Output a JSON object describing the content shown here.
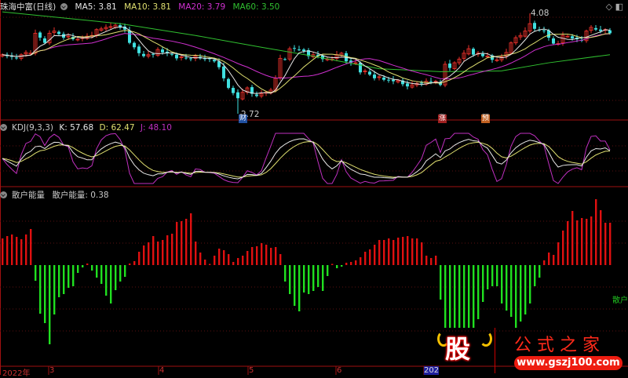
{
  "header": {
    "stock_name": "珠海中富(日线)",
    "ma5": "MA5: 3.81",
    "ma10": "MA10: 3.81",
    "ma20": "MA20: 3.79",
    "ma60": "MA60: 3.50",
    "high_label": "4.08",
    "low_label": "2.72"
  },
  "kdj": {
    "title": "KDJ(9,3,3)",
    "k": "K: 57.68",
    "d": "D: 62.47",
    "j": "J: 48.10"
  },
  "energy": {
    "title": "散户能量",
    "value": "散户能量: 0.38",
    "right_label": "散户"
  },
  "markers": {
    "cai": "财",
    "zhang": "涨",
    "yu": "预"
  },
  "time_axis": {
    "year": "2022年",
    "m3": "3",
    "m4": "4",
    "m5": "5",
    "m6": "6",
    "current": "202"
  },
  "watermark": {
    "logo": "股",
    "title": "公式之家",
    "url": "www.gszj100.com"
  },
  "colors": {
    "up": "#e8302a",
    "down": "#40e0e0",
    "ma5": "#e8e8e8",
    "ma10": "#e0e070",
    "ma20": "#d030d0",
    "ma60": "#30c030",
    "bar_up": "#e01010",
    "bar_down": "#20e020",
    "k": "#e8e8e8",
    "d": "#e0e070",
    "j": "#c030c0"
  },
  "chart_data": {
    "type": "candlestick",
    "price_range": [
      2.72,
      4.08
    ],
    "closes": [
      3.52,
      3.5,
      3.49,
      3.47,
      3.52,
      3.55,
      3.54,
      3.81,
      3.75,
      3.68,
      3.81,
      3.84,
      3.8,
      3.75,
      3.77,
      3.73,
      3.73,
      3.75,
      3.77,
      3.78,
      3.86,
      3.87,
      3.89,
      3.9,
      3.92,
      3.89,
      3.86,
      3.68,
      3.62,
      3.54,
      3.5,
      3.52,
      3.52,
      3.59,
      3.55,
      3.54,
      3.52,
      3.47,
      3.49,
      3.47,
      3.46,
      3.5,
      3.47,
      3.46,
      3.46,
      3.43,
      3.35,
      3.2,
      3.07,
      3.0,
      2.93,
      3.01,
      3.07,
      2.99,
      2.96,
      2.99,
      3.01,
      3.04,
      3.2,
      3.47,
      3.46,
      3.6,
      3.6,
      3.59,
      3.57,
      3.5,
      3.52,
      3.5,
      3.46,
      3.46,
      3.46,
      3.52,
      3.54,
      3.43,
      3.41,
      3.41,
      3.28,
      3.3,
      3.25,
      3.2,
      3.22,
      3.18,
      3.17,
      3.16,
      3.17,
      3.12,
      3.09,
      3.11,
      3.13,
      3.13,
      3.16,
      3.15,
      3.16,
      3.11,
      3.39,
      3.34,
      3.41,
      3.46,
      3.54,
      3.6,
      3.52,
      3.54,
      3.5,
      3.5,
      3.45,
      3.45,
      3.49,
      3.55,
      3.68,
      3.75,
      3.78,
      3.84,
      3.94,
      3.87,
      3.85,
      3.84,
      3.75,
      3.67,
      3.67,
      3.78,
      3.77,
      3.74,
      3.73,
      3.71,
      3.84,
      3.89,
      3.86,
      3.84,
      3.86,
      3.81
    ],
    "ma60_anchors": [
      [
        0,
        4.1
      ],
      [
        25,
        3.94
      ],
      [
        41,
        3.78
      ],
      [
        55,
        3.62
      ],
      [
        66,
        3.5
      ],
      [
        80,
        3.33
      ],
      [
        93,
        3.29
      ],
      [
        106,
        3.3
      ],
      [
        116,
        3.41
      ],
      [
        129,
        3.52
      ]
    ],
    "energy_values": [
      34,
      37,
      39,
      36,
      33,
      39,
      46,
      -20,
      -62,
      -74,
      -101,
      -63,
      -41,
      -37,
      -29,
      -27,
      -10,
      -3,
      2,
      -7,
      -16,
      -24,
      -39,
      -49,
      -32,
      -21,
      -15,
      2,
      5,
      17,
      25,
      29,
      37,
      30,
      32,
      38,
      40,
      55,
      56,
      59,
      66,
      30,
      16,
      7,
      1,
      12,
      21,
      19,
      14,
      4,
      9,
      12,
      18,
      23,
      24,
      28,
      26,
      22,
      23,
      14,
      -21,
      -37,
      -52,
      -59,
      -35,
      -37,
      -33,
      -28,
      -33,
      -14,
      1,
      -4,
      -2,
      3,
      4,
      6,
      10,
      17,
      20,
      26,
      32,
      32,
      34,
      32,
      35,
      36,
      37,
      34,
      34,
      29,
      12,
      9,
      12,
      -44,
      -80,
      -80,
      -80,
      -80,
      -80,
      -80,
      -80,
      -69,
      -47,
      -31,
      -27,
      -27,
      -49,
      -58,
      -66,
      -80,
      -72,
      -63,
      -49,
      -27,
      -16,
      6,
      16,
      13,
      29,
      44,
      56,
      69,
      57,
      60,
      59,
      62,
      84,
      70,
      54,
      54
    ]
  }
}
